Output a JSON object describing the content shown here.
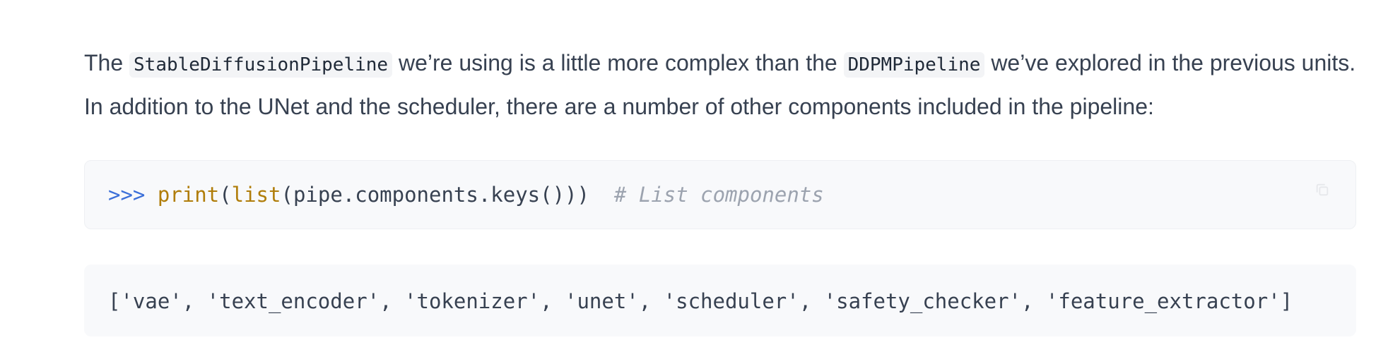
{
  "paragraph": {
    "part1": "The ",
    "code1": "StableDiffusionPipeline",
    "part2": " we’re using is a little more complex than the ",
    "code2": "DDPMPipeline",
    "part3": " we’ve explored in the previous units. In addition to the UNet and the scheduler, there are a number of other components included in the pipeline:"
  },
  "code_input": {
    "prompt": ">>>",
    "fn_print": "print",
    "paren_open": "(",
    "fn_list": "list",
    "args": "(pipe.components.keys()))",
    "comment": "# List components"
  },
  "code_output": {
    "text": "['vae', 'text_encoder', 'tokenizer', 'unet', 'scheduler', 'safety_checker', 'feature_extractor']"
  },
  "icons": {
    "copy": "copy-icon"
  }
}
